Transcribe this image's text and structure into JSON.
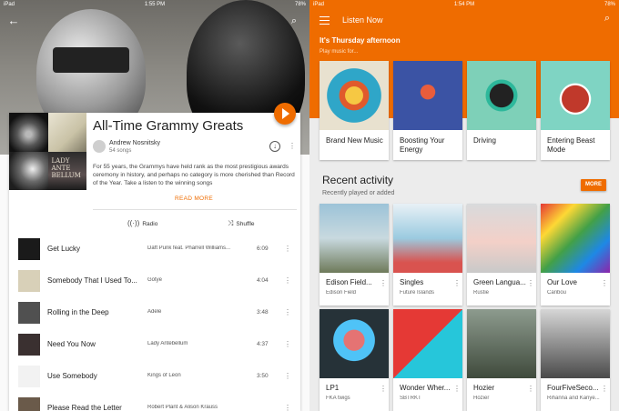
{
  "left": {
    "status": {
      "carrier": "iPad",
      "time": "1:55 PM",
      "battery": "78%"
    },
    "back_icon": "back-arrow-icon",
    "search_icon": "search-icon",
    "playlist": {
      "title": "All-Time Grammy Greats",
      "owner": "Andrew Nosnitsky",
      "song_count": "54 songs",
      "description": "For 55 years, the Grammys have held rank as the most prestigious awards ceremony in history, and perhaps no category is more cherished than Record of the Year. Take a listen to the winning songs",
      "read_more": "READ MORE",
      "radio_label": "Radio",
      "shuffle_label": "Shuffle",
      "collage_text": "LADY\nANTE\nBELLUM"
    },
    "tracks": [
      {
        "name": "Get Lucky",
        "artist": "Daft Punk feat. Pharrell Williams...",
        "duration": "6:09",
        "art": "#1a1a1a"
      },
      {
        "name": "Somebody That I Used To...",
        "artist": "Gotye",
        "duration": "4:04",
        "art": "#d8d0b8"
      },
      {
        "name": "Rolling in the Deep",
        "artist": "Adele",
        "duration": "3:48",
        "art": "#505050"
      },
      {
        "name": "Need You Now",
        "artist": "Lady Antebellum",
        "duration": "4:37",
        "art": "#3a3030"
      },
      {
        "name": "Use Somebody",
        "artist": "Kings of Leon",
        "duration": "3:50",
        "art": "#f2f2f2"
      },
      {
        "name": "Please Read the Letter",
        "artist": "Robert Plant & Alison Krauss",
        "duration": "",
        "art": "#6a5a4a"
      }
    ]
  },
  "right": {
    "status": {
      "carrier": "iPad",
      "time": "1:54 PM",
      "battery": "78%"
    },
    "app_title": "Listen Now",
    "greeting": "It's Thursday afternoon",
    "greeting_sub": "Play music for...",
    "moods": [
      {
        "label": "Brand New Music"
      },
      {
        "label": "Boosting Your Energy"
      },
      {
        "label": "Driving"
      },
      {
        "label": "Entering Beast Mode"
      }
    ],
    "recent": {
      "title": "Recent activity",
      "subtitle": "Recently played or added",
      "more": "MORE",
      "items": [
        {
          "title": "Edison Field...",
          "artist": "Edison Field"
        },
        {
          "title": "Singles",
          "artist": "Future Islands"
        },
        {
          "title": "Green Langua...",
          "artist": "Rustie"
        },
        {
          "title": "Our Love",
          "artist": "Caribou"
        },
        {
          "title": "LP1",
          "artist": "FKA twigs"
        },
        {
          "title": "Wonder Wher...",
          "artist": "SBTRKT"
        },
        {
          "title": "Hozier",
          "artist": "Hozier"
        },
        {
          "title": "FourFiveSeco...",
          "artist": "Rihanna and Kanye..."
        }
      ]
    }
  },
  "colors": {
    "accent": "#ef6c00",
    "app_bar": "#ef6c00"
  }
}
